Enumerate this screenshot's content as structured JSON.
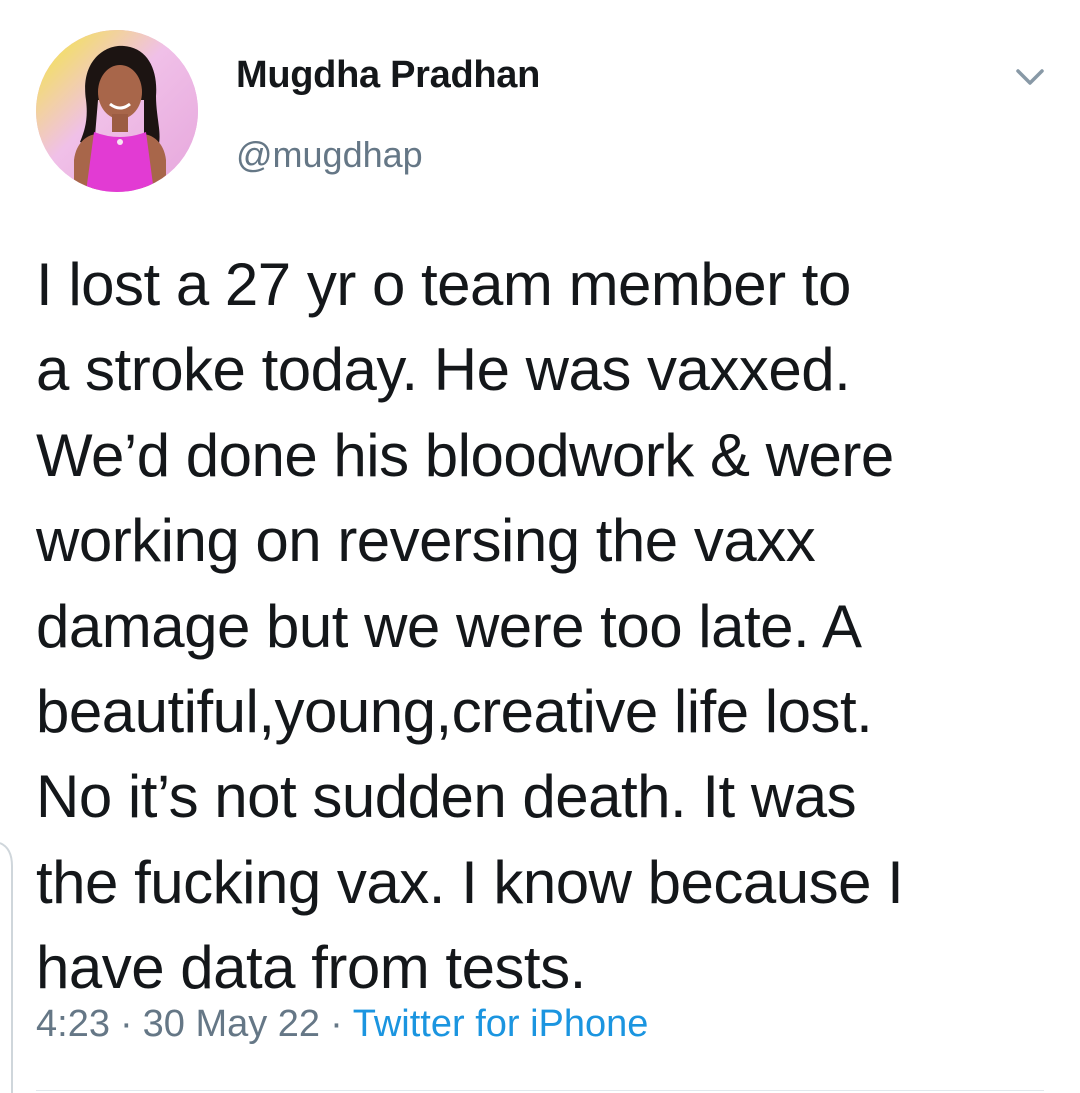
{
  "tweet": {
    "author": {
      "display_name": "Mugdha Pradhan",
      "handle": "@mugdhap",
      "avatar": "profile-photo"
    },
    "menu_icon": "chevron-down-icon",
    "text_lines": [
      "I lost a 27 yr o team member to",
      "a stroke today. He was vaxxed.",
      "We’d done his bloodwork & were",
      "working on reversing the vaxx",
      "damage but we were too late. A",
      "beautiful,young,creative life lost.",
      "No it’s not sudden death. It was",
      "the fucking vax. I know because I",
      "have data from tests."
    ],
    "time": "4:23",
    "date": "30 May 22",
    "separator": "·",
    "source": "Twitter for iPhone"
  },
  "colors": {
    "text": "#14171a",
    "secondary": "#657786",
    "link": "#1b95e0",
    "divider": "#e1e8ed"
  }
}
